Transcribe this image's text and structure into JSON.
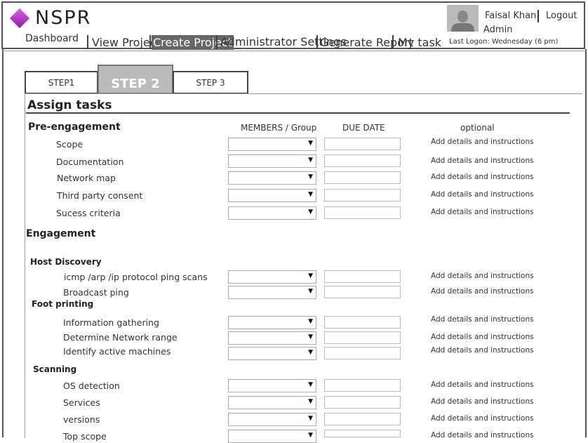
{
  "app": {
    "logo_text": "NSPR"
  },
  "nav": {
    "items": [
      "Dashboard",
      "View Projects",
      "Create Project",
      "Administrator Settings",
      "Generate Report",
      "My task"
    ]
  },
  "user": {
    "name": "Faisal Khan",
    "logout": "Logout",
    "role": "Admin",
    "last_logon": "Last Logon:  Wednesday (6 pm)"
  },
  "steps": [
    "STEP1",
    "STEP 2",
    "STEP 3"
  ],
  "panel_title": "Assign tasks",
  "columns": {
    "members": "MEMBERS / Group",
    "due_date": "DUE DATE",
    "optional": "optional"
  },
  "details_label": "Add details and instructions",
  "pre_engagement": {
    "title": "Pre-engagement",
    "tasks": [
      "Scope",
      "Documentation",
      "Network map",
      "Third party consent",
      "Sucess criteria"
    ]
  },
  "engagement": {
    "title": "Engagement",
    "groups": [
      {
        "title": "Host Discovery",
        "tasks": [
          "icmp /arp /ip protocol ping scans",
          "Broadcast ping"
        ]
      },
      {
        "title": "Foot printing",
        "tasks": [
          "Information gathering",
          "Determine Network range",
          "Identify active machines"
        ]
      },
      {
        "title": "Scanning",
        "tasks": [
          "OS detection",
          "Services",
          "versions",
          "Top scope"
        ]
      }
    ]
  },
  "icons": {
    "dropdown": "▼"
  },
  "colors": {
    "logo_accent": "#b040c8",
    "active_nav_bg": "#666666",
    "active_step_bg": "#bbbbbb"
  }
}
